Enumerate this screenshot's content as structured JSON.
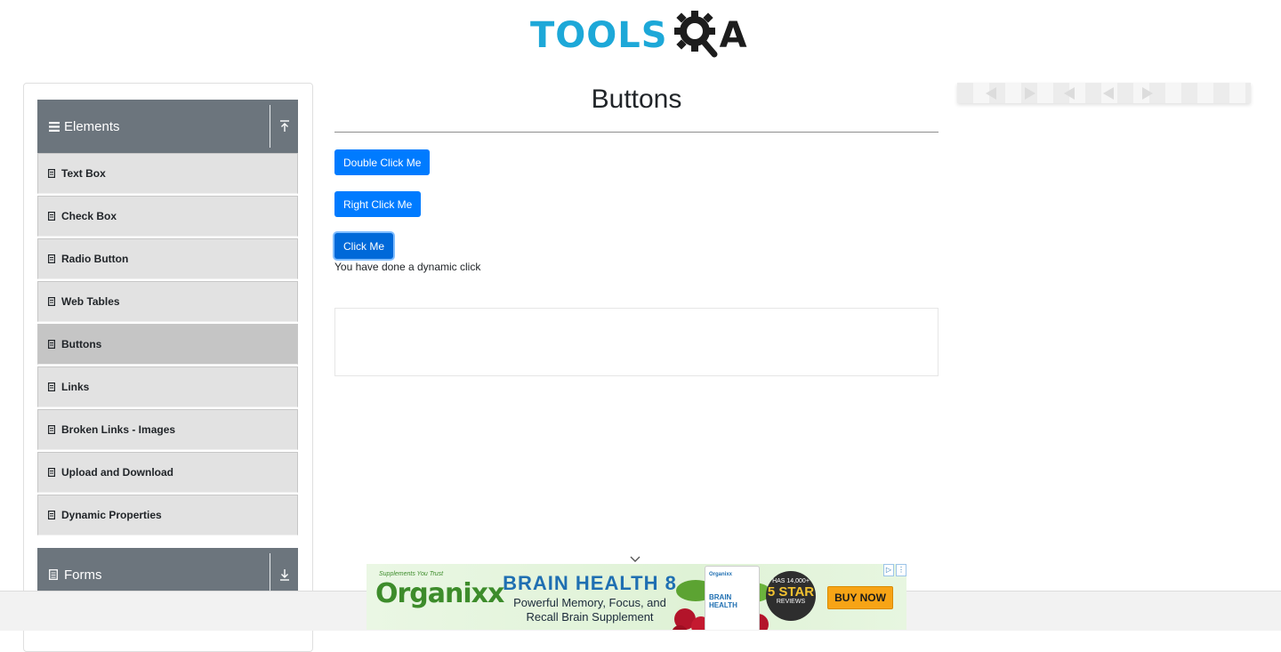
{
  "header": {
    "logo_text_left": "TOOLS",
    "logo_text_right": "A",
    "logo_icon": "gear-magnifier-icon"
  },
  "sidebar": {
    "groups": [
      {
        "label": "Elements",
        "icon": "bars-icon",
        "toggle_icon": "arrow-up-icon"
      },
      {
        "label": "Forms",
        "icon": "document-icon",
        "toggle_icon": "arrow-down-icon"
      }
    ],
    "items": [
      {
        "label": "Text Box",
        "active": false
      },
      {
        "label": "Check Box",
        "active": false
      },
      {
        "label": "Radio Button",
        "active": false
      },
      {
        "label": "Web Tables",
        "active": false
      },
      {
        "label": "Buttons",
        "active": true
      },
      {
        "label": "Links",
        "active": false
      },
      {
        "label": "Broken Links - Images",
        "active": false
      },
      {
        "label": "Upload and Download",
        "active": false
      },
      {
        "label": "Dynamic Properties",
        "active": false
      }
    ]
  },
  "main": {
    "title": "Buttons",
    "buttons": {
      "double_click": "Double Click Me",
      "right_click": "Right Click Me",
      "click": "Click Me"
    },
    "message": "You have done a dynamic click"
  },
  "ad": {
    "brand": "Organixx",
    "brand_tagline": "Supplements You Trust",
    "headline": "BRAIN HEALTH 8",
    "subline1": "Powerful Memory, Focus, and",
    "subline2": "Recall Brain Supplement",
    "bottle_brand": "Organixx",
    "bottle_title": "BRAIN HEALTH",
    "seal_top": "HAS 14,000+",
    "seal_main": "5 STAR",
    "seal_bottom": "REVIEWS",
    "cta": "BUY NOW"
  },
  "colors": {
    "primary_button": "#007bff",
    "logo_blue": "#1da8d8",
    "group_header": "#6c757d",
    "menu_item": "#e2e2e2",
    "menu_item_active": "#c5c5c5"
  }
}
